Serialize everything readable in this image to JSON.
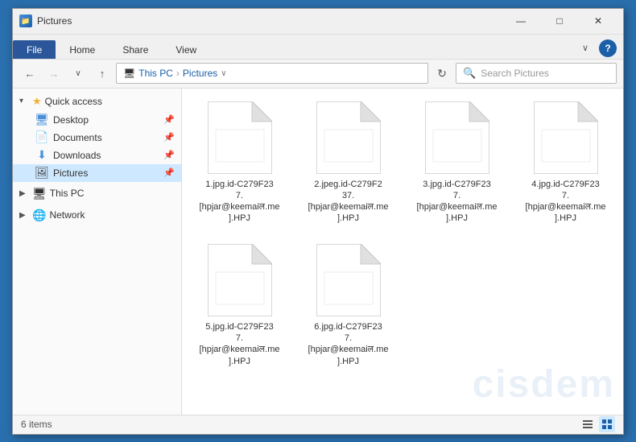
{
  "window": {
    "title": "Pictures",
    "icon": "📁"
  },
  "title_bar": {
    "controls": {
      "minimize": "—",
      "maximize": "□",
      "close": "✕"
    }
  },
  "ribbon": {
    "tabs": [
      "File",
      "Home",
      "Share",
      "View"
    ],
    "active_tab": "File",
    "chevron": "∨",
    "help": "?"
  },
  "address_bar": {
    "back": "←",
    "forward": "→",
    "dropdown": "∨",
    "up": "↑",
    "breadcrumbs": [
      "This PC",
      "Pictures"
    ],
    "breadcrumb_chevron": "›",
    "refresh": "↻",
    "search_placeholder": "Search Pictures"
  },
  "sidebar": {
    "quick_access": {
      "label": "Quick access",
      "chevron": "▾",
      "star": "★",
      "items": [
        {
          "id": "desktop",
          "label": "Desktop",
          "icon": "🖥",
          "pinned": true
        },
        {
          "id": "documents",
          "label": "Documents",
          "icon": "📄",
          "pinned": true
        },
        {
          "id": "downloads",
          "label": "Downloads",
          "icon": "⬇",
          "pinned": true
        },
        {
          "id": "pictures",
          "label": "Pictures",
          "icon": "🖼",
          "pinned": true,
          "active": true
        }
      ]
    },
    "this_pc": {
      "label": "This PC",
      "chevron": "▶"
    },
    "network": {
      "label": "Network",
      "chevron": "▶"
    }
  },
  "files": [
    {
      "id": "file1",
      "name": "1.jpg.id-C279F23\n7.[hpjar@keemaiल.me].HPJ"
    },
    {
      "id": "file2",
      "name": "2.jpeg.id-C279F2\n37.[hpjar@keemaiल.me].HPJ"
    },
    {
      "id": "file3",
      "name": "3.jpg.id-C279F23\n7.[hpjar@keemaiल.me].HPJ"
    },
    {
      "id": "file4",
      "name": "4.jpg.id-C279F23\n7.[hpjar@keemaiल.me].HPJ"
    },
    {
      "id": "file5",
      "name": "5.jpg.id-C279F23\n7.[hpjar@keemaiल.me].HPJ"
    },
    {
      "id": "file6",
      "name": "6.jpg.id-C279F23\n7.[hpjar@keemaiल.me].HPJ"
    }
  ],
  "file_names_display": [
    "1.jpg.id-C279F23\n7.[hpjar@keemaiल.me].HPJ",
    "2.jpeg.id-C279F2\n37.[hpjar@keemaiल.me].HPJ",
    "3.jpg.id-C279F23\n7.[hpjar@keemaiल.me].HPJ",
    "4.jpg.id-C279F23\n7.[hpjar@keemaiल.me].HPJ",
    "5.jpg.id-C279F23\n7.[hpjar@keemaiल.me].HPJ",
    "6.jpg.id-C279F23\n7.[hpjar@keemaiल.me].HPJ"
  ],
  "status_bar": {
    "items_count": "6 items",
    "view_list": "☰",
    "view_grid": "⊞"
  }
}
